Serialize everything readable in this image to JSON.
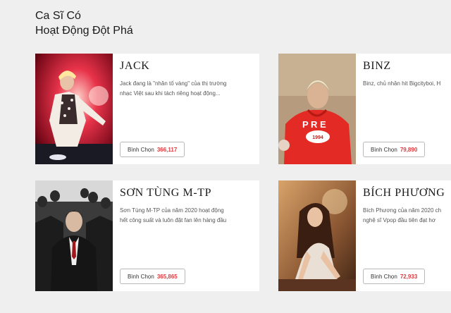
{
  "section": {
    "title_line1": "Ca Sĩ Có",
    "title_line2": "Hoạt Động Đột Phá"
  },
  "artists": [
    {
      "name": "JACK",
      "desc_line1": "Jack đang là \"nhân tố vàng\" của thị trường",
      "desc_line2": "nhạc Việt sau khi tách riêng hoạt động...",
      "vote_label": "Bình Chọn",
      "votes": "366,117"
    },
    {
      "name": "BINZ",
      "desc_line1": "Binz, chủ nhân hit Bigcityboi, H",
      "desc_line2": "",
      "vote_label": "Bình Chọn",
      "votes": "79,890"
    },
    {
      "name": "SƠN TÙNG M-TP",
      "desc_line1": "Sơn Tùng M-TP của năm 2020 hoạt động",
      "desc_line2": "hết công suất và luôn đặt fan lên hàng đầu",
      "vote_label": "Bình Chọn",
      "votes": "365,865"
    },
    {
      "name": "BÍCH PHƯƠNG",
      "desc_line1": "Bích Phương của năm 2020 ch",
      "desc_line2": "nghệ sĩ Vpop đầu tiên đạt hơ",
      "vote_label": "Bình Chọn",
      "votes": "72,933"
    }
  ],
  "photo_texts": {
    "binz_hoodie": "P R E",
    "binz_badge": "1994"
  },
  "colors": {
    "page_bg": "#efefef",
    "card_bg": "#ffffff",
    "vote_count": "#e0393e",
    "button_border": "#b9b9b9"
  }
}
